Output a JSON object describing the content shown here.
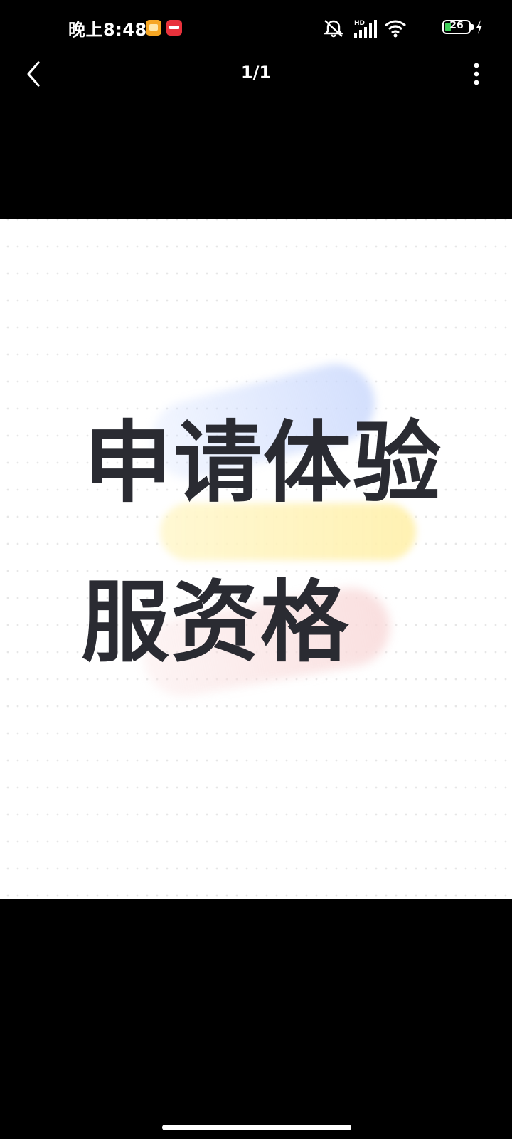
{
  "status_bar": {
    "time": "晚上8:48",
    "battery_level": "26",
    "battery_fill_percent": 26,
    "icons": [
      "message-app-icon",
      "news-app-icon",
      "mute-icon",
      "signal-icon",
      "wifi-icon",
      "battery-icon",
      "charging-bolt-icon"
    ]
  },
  "nav": {
    "page_counter": "1/1",
    "back_icon": "chevron-left-icon",
    "more_icon": "more-vertical-icon"
  },
  "image": {
    "line1": "申请体验",
    "line2": "服资格"
  },
  "colors": {
    "background": "#000000",
    "image_background": "#ffffff",
    "headline_text": "#2a2b32",
    "battery_green": "#3fd05a",
    "news_badge_red": "#e8323c",
    "message_badge_orange": "#f6a623"
  }
}
